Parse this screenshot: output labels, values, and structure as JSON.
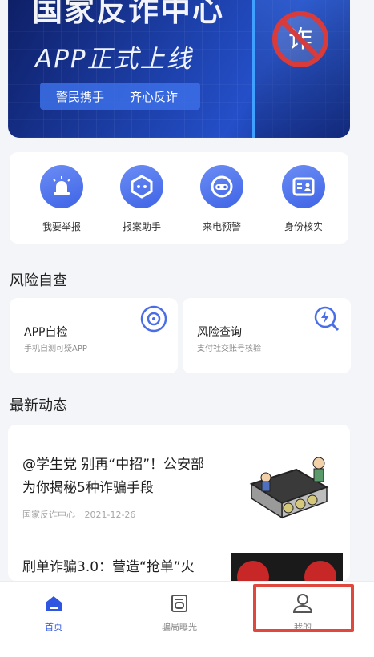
{
  "banner": {
    "line1": "国家反诈中心",
    "line2": "APP正式上线",
    "slogan1": "警民携手",
    "slogan2": "齐心反诈",
    "sign_char": "诈"
  },
  "actions": [
    {
      "label": "我要举报",
      "icon": "alarm-icon"
    },
    {
      "label": "报案助手",
      "icon": "hexagon-robot-icon"
    },
    {
      "label": "来电预警",
      "icon": "call-warning-icon"
    },
    {
      "label": "身份核实",
      "icon": "id-card-icon"
    }
  ],
  "risk_section": {
    "title": "风险自查",
    "cards": [
      {
        "title": "APP自检",
        "subtitle": "手机自测可疑APP",
        "icon": "scan-icon"
      },
      {
        "title": "风险查询",
        "subtitle": "支付社交账号核验",
        "icon": "search-bolt-icon"
      }
    ]
  },
  "news_section": {
    "title": "最新动态",
    "items": [
      {
        "title_line1": "@学生党 别再“中招”！公安部",
        "title_line2": "为你揭秘5种诈骗手段",
        "source": "国家反诈中心",
        "date": "2021-12-26"
      },
      {
        "title_line1": "刷单诈骗3.0：营造“抢单”火"
      }
    ]
  },
  "bottom_nav": [
    {
      "label": "首页",
      "icon": "home-icon",
      "active": true
    },
    {
      "label": "骗局曝光",
      "icon": "news-icon",
      "active": false
    },
    {
      "label": "我的",
      "icon": "user-icon",
      "active": false
    }
  ],
  "colors": {
    "accent": "#3f64e6",
    "highlight": "#e0483e"
  }
}
